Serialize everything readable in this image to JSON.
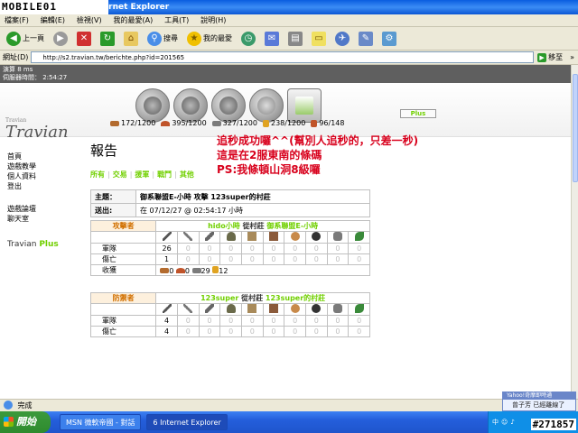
{
  "window": {
    "watermark_logo": "MOBILE01",
    "title": "Internet Explorer"
  },
  "menu": [
    "檔案(F)",
    "編輯(E)",
    "檢視(V)",
    "我的最愛(A)",
    "工具(T)",
    "說明(H)"
  ],
  "toolbar": {
    "back_label": "上一頁",
    "search_label": "搜尋",
    "favorites_label": "我的最愛"
  },
  "address": {
    "label": "網址(D)",
    "url": "http://s2.travian.tw/berichte.php?id=201565",
    "go_label": "移至",
    "links_label": "»"
  },
  "clock": {
    "line1": "演算 8 ms",
    "line2": "伺服器時間：  2:54:27"
  },
  "plus_button": "Plus",
  "logo": {
    "sub": "Travian",
    "main": "Travian"
  },
  "nav": {
    "group1": [
      "首頁",
      "遊戲教學",
      "個人資料",
      "登出"
    ],
    "group2": [
      "遊戲論壇",
      "聊天室"
    ],
    "plus_prefix": "Travian",
    "plus_suffix": "Plus"
  },
  "resources": [
    {
      "name": "wood",
      "value": "172/1200",
      "color": "#b36b2e"
    },
    {
      "name": "clay",
      "value": "395/1200",
      "color": "#c0542a"
    },
    {
      "name": "iron",
      "value": "327/1200",
      "color": "#7b7b7b"
    },
    {
      "name": "crop",
      "value": "238/1200",
      "color": "#e0a321"
    },
    {
      "name": "crop-usage",
      "value": "96/148",
      "color": "#c0542a"
    }
  ],
  "heading": "報告",
  "tabs": [
    "所有",
    "交易",
    "援軍",
    "戰鬥",
    "其他"
  ],
  "note": {
    "line1": "追秒成功囉^^(幫別人追秒的，只差一秒)",
    "line2": "這是在2服東南的條碼",
    "line3": "PS:我條頓山洞8級囉"
  },
  "report": {
    "subject_label": "主題：",
    "subject": "御系聯盟E-小時 攻擊 123super的村莊",
    "sent_label": "送出:",
    "sent": "在 07/12/27 @ 02:54:17 小時"
  },
  "attacker": {
    "role": "攻擊者",
    "player": "hido小時",
    "from": "從村莊",
    "village": "御系聯盟E-小時",
    "troops_label": "軍隊",
    "losses_label": "傷亡",
    "bounty_label": "收獲",
    "troops": [
      "26",
      "0",
      "0",
      "0",
      "0",
      "0",
      "0",
      "0",
      "0",
      "0"
    ],
    "losses": [
      "1",
      "0",
      "0",
      "0",
      "0",
      "0",
      "0",
      "0",
      "0",
      "0"
    ],
    "bounty": [
      "0",
      "0",
      "29",
      "12"
    ]
  },
  "defender": {
    "role": "防禦者",
    "player": "123super",
    "from": "從村莊",
    "village": "123super的村莊",
    "troops_label": "軍隊",
    "losses_label": "傷亡",
    "troops": [
      "4",
      "0",
      "0",
      "0",
      "0",
      "0",
      "0",
      "0",
      "0",
      "0"
    ],
    "losses": [
      "4",
      "0",
      "0",
      "0",
      "0",
      "0",
      "0",
      "0",
      "0",
      "0"
    ]
  },
  "statusbar": {
    "text": "完成"
  },
  "yahoo": {
    "bar": "Yahoo!奇摩即時通",
    "text": "曾子芳 已經離線了"
  },
  "taskbar": {
    "start": "開始",
    "tasks": [
      "MSN 微軟帝國 - 對話",
      "6 Internet Explorer"
    ],
    "watermark": "#271857"
  }
}
